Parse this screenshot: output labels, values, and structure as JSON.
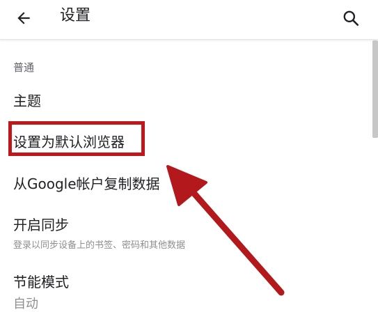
{
  "header": {
    "title": "设置",
    "back_icon": "arrow-left-icon",
    "search_icon": "search-icon"
  },
  "sections": {
    "general": {
      "header": "普通",
      "items": [
        {
          "label": "主题"
        },
        {
          "label": "设置为默认浏览器"
        },
        {
          "label": "从Google帐户复制数据"
        },
        {
          "label": "开启同步",
          "sublabel": "登录以同步设备上的书签、密码和其他数据"
        },
        {
          "label": "节能模式",
          "sublabel": "自动"
        }
      ]
    }
  },
  "annotation": {
    "highlight_color": "#c0181a",
    "arrow_color": "#b3191c",
    "highlighted_item": "设置为默认浏览器"
  }
}
